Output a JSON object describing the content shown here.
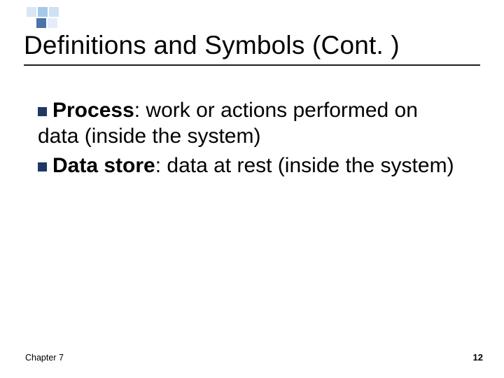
{
  "title": "Definitions and Symbols (Cont. )",
  "bullets": [
    {
      "term": "Process",
      "text": ": work or actions performed on data (inside the system)"
    },
    {
      "term": "Data store",
      "text": ": data at rest (inside the system)"
    }
  ],
  "footer": {
    "left": "Chapter 7",
    "page": "12"
  },
  "colors": {
    "bullet": "#203864",
    "rule": "#1f1f1f"
  }
}
